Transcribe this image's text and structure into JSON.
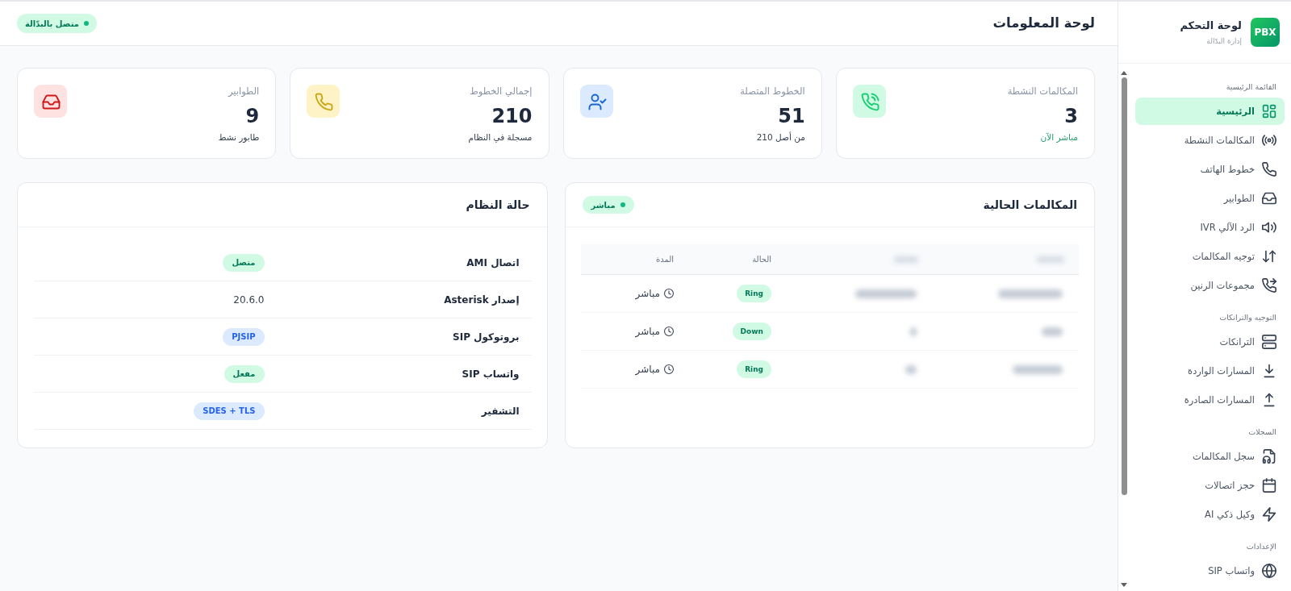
{
  "sidebar": {
    "logo": "PBX",
    "title": "لوحة التحكم",
    "subtitle": "إدارة البدّالة",
    "sections": [
      {
        "label": "القائمة الرئيسية",
        "items": [
          {
            "label": "الرئيسية",
            "selected": true
          },
          {
            "label": "المكالمات النشطة",
            "selected": false
          },
          {
            "label": "خطوط الهاتف",
            "selected": false
          },
          {
            "label": "الطوابير",
            "selected": false
          },
          {
            "label": "الرد الآلي IVR",
            "selected": false
          },
          {
            "label": "توجيه المكالمات",
            "selected": false
          },
          {
            "label": "مجموعات الرنين",
            "selected": false
          }
        ]
      },
      {
        "label": "التوجيه والترانكات",
        "items": [
          {
            "label": "الترانكات",
            "selected": false
          },
          {
            "label": "المسارات الواردة",
            "selected": false
          },
          {
            "label": "المسارات الصادرة",
            "selected": false
          }
        ]
      },
      {
        "label": "السجلات",
        "items": [
          {
            "label": "سجل المكالمات",
            "selected": false
          },
          {
            "label": "حجز اتصالات",
            "selected": false
          },
          {
            "label": "وكيل ذكي AI",
            "selected": false
          }
        ]
      },
      {
        "label": "الإعدادات",
        "items": [
          {
            "label": "واتساب SIP",
            "selected": false
          }
        ]
      }
    ]
  },
  "header": {
    "title": "لوحة المعلومات",
    "connection_badge": {
      "label": "متصل بالبدّالة",
      "online": true
    }
  },
  "stats": [
    {
      "label": "المكالمات النشطة",
      "value": "3",
      "note": "مباشر الآن",
      "note_highlighted": true,
      "color": "#d1fae5"
    },
    {
      "label": "الخطوط المتصلة",
      "value": "51",
      "note": "من أصل 210",
      "note_highlighted": false,
      "color": "#dbeafe"
    },
    {
      "label": "إجمالي الخطوط",
      "value": "210",
      "note": "مسجلة في النظام",
      "note_highlighted": false,
      "color": "#fef3c7"
    },
    {
      "label": "الطوابير",
      "value": "9",
      "note": "طابور نشط",
      "note_highlighted": false,
      "color": "#fee2e2"
    }
  ],
  "current_calls": {
    "title": "المكالمات الحالية",
    "live_badge": {
      "label": "مباشر",
      "online": true
    },
    "columns": [
      "الحالة",
      "المدة"
    ],
    "rows": [
      {
        "status": "Ring",
        "duration": "مباشر"
      },
      {
        "status": "Down",
        "duration": "مباشر"
      },
      {
        "status": "Ring",
        "duration": "مباشر"
      }
    ]
  },
  "system_status": {
    "title": "حالة النظام",
    "rows": [
      {
        "label": "اتصال AMI",
        "value": "متصل",
        "kind": "success"
      },
      {
        "label": "إصدار Asterisk",
        "value": "20.6.0",
        "kind": "text"
      },
      {
        "label": "بروتوكول SIP",
        "value": "PJSIP",
        "kind": "info"
      },
      {
        "label": "واتساب SIP",
        "value": "مفعل",
        "kind": "success"
      },
      {
        "label": "التشفير",
        "value": "SDES + TLS",
        "kind": "info"
      }
    ]
  }
}
